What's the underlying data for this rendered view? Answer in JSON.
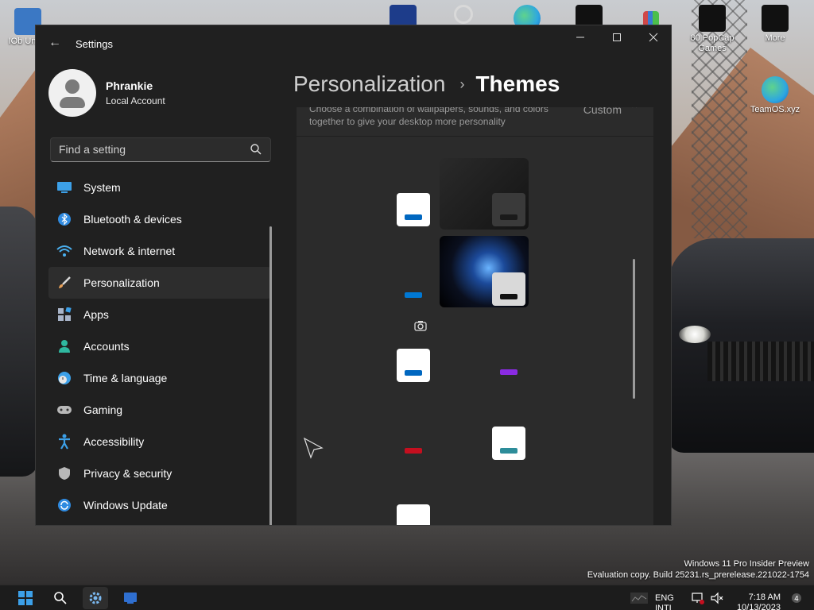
{
  "desktop": {
    "icons": [
      {
        "id": "iobit",
        "label": "IOb Unloc",
        "color": "#3b78c4"
      },
      {
        "id": "nfs",
        "label": "",
        "color": "#1d3c8a"
      },
      {
        "id": "icon-ring",
        "label": "",
        "color": "#d9d9d9"
      },
      {
        "id": "edge",
        "label": "",
        "color": "#2ea7e0"
      },
      {
        "id": "black-app",
        "label": "",
        "color": "#111111"
      },
      {
        "id": "bars",
        "label": "",
        "color": "#d04848"
      },
      {
        "id": "popcap",
        "label": "80 PopCap Games",
        "color": "#111111"
      },
      {
        "id": "more",
        "label": "More",
        "color": "#111111"
      },
      {
        "id": "teamos",
        "label": "TeamOS.xyz",
        "color": "#2ea7e0"
      }
    ],
    "watermark": {
      "line1": "Windows 11 Pro Insider Preview",
      "line2": "Evaluation copy. Build 25231.rs_prerelease.221022-1754"
    }
  },
  "window": {
    "title": "Settings",
    "back_icon": "back-arrow-icon",
    "controls": [
      "minimize-icon",
      "maximize-icon",
      "close-icon"
    ]
  },
  "profile": {
    "name": "Phrankie",
    "account_type": "Local Account"
  },
  "search": {
    "placeholder": "Find a setting",
    "icon": "search-icon"
  },
  "nav": {
    "selected": "Personalization",
    "items": [
      {
        "label": "System",
        "icon": "system-icon",
        "color": "#3ca0e8"
      },
      {
        "label": "Bluetooth & devices",
        "icon": "bluetooth-icon",
        "color": "#2f8ae0"
      },
      {
        "label": "Network & internet",
        "icon": "network-icon",
        "color": "#4ab0f0"
      },
      {
        "label": "Personalization",
        "icon": "brush-icon",
        "color": "#e8a058"
      },
      {
        "label": "Apps",
        "icon": "apps-icon",
        "color": "#a8b4c8"
      },
      {
        "label": "Accounts",
        "icon": "accounts-icon",
        "color": "#2fb8a0"
      },
      {
        "label": "Time & language",
        "icon": "time-language-icon",
        "color": "#3ca0e8"
      },
      {
        "label": "Gaming",
        "icon": "gaming-icon",
        "color": "#b8b8b8"
      },
      {
        "label": "Accessibility",
        "icon": "accessibility-icon",
        "color": "#3ca0e8"
      },
      {
        "label": "Privacy & security",
        "icon": "shield-icon",
        "color": "#b8b8b8"
      },
      {
        "label": "Windows Update",
        "icon": "update-icon",
        "color": "#2f8ae0"
      }
    ]
  },
  "content": {
    "breadcrumb_parent": "Personalization",
    "breadcrumb_separator": "›",
    "breadcrumb_current": "Themes",
    "current_theme": {
      "description": "Choose a combination of wallpapers, sounds, and colors together to give your desktop more personality",
      "value": "Custom"
    },
    "theme_accents": [
      "#0067c0",
      "#0078d4",
      "#0067c0",
      "#8a2be2",
      "#c50f1f",
      "#2d8d9a",
      "#555555"
    ]
  },
  "taskbar": {
    "language": "ENG",
    "layout": "INTL",
    "time": "7:18 AM",
    "date": "10/13/2023",
    "icons": [
      "start-icon",
      "search-icon",
      "settings-icon",
      "app-icon"
    ]
  }
}
